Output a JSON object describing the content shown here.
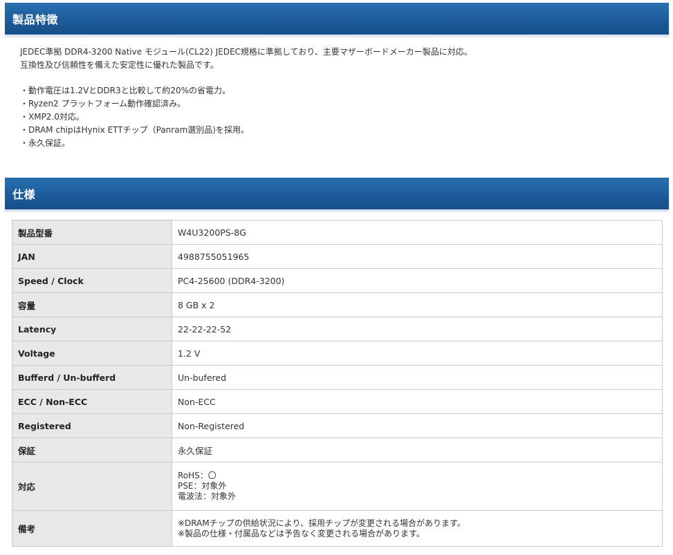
{
  "features": {
    "title": "製品特徴",
    "lines": [
      "JEDEC準拠 DDR4-3200 Native モジュール(CL22) JEDEC規格に準拠しており、主要マザーボードメーカー製品に対応。",
      "互換性及び信頼性を備えた安定性に優れた製品です。"
    ],
    "bullets": [
      "・動作電圧は1.2VとDDR3と比較して約20%の省電力。",
      "・Ryzen2 プラットフォーム動作確認済み。",
      "・XMP2.0対応。",
      "・DRAM chipはHynix ETTチップ（Panram選別品)を採用。",
      "・永久保証。"
    ]
  },
  "specs": {
    "title": "仕様",
    "rows": [
      {
        "label": "製品型番",
        "value": "W4U3200PS-8G"
      },
      {
        "label": "JAN",
        "value": "4988755051965"
      },
      {
        "label": "Speed / Clock",
        "value": "PC4-25600 (DDR4-3200)"
      },
      {
        "label": "容量",
        "value": "8 GB x 2"
      },
      {
        "label": "Latency",
        "value": "22-22-22-52"
      },
      {
        "label": "Voltage",
        "value": "1.2 V"
      },
      {
        "label": "Bufferd / Un-bufferd",
        "value": "Un-bufered"
      },
      {
        "label": "ECC / Non-ECC",
        "value": "Non-ECC"
      },
      {
        "label": "Registered",
        "value": "Non-Registered"
      },
      {
        "label": "保証",
        "value": "永久保証"
      }
    ],
    "compat": {
      "label": "対応",
      "lines": [
        "RoHS：〇",
        "PSE：対象外",
        "電波法：対象外"
      ]
    },
    "notes": {
      "label": "備考",
      "lines": [
        "※DRAMチップの供給状況により、採用チップが変更される場合があります。",
        "※製品の仕様・付属品などは予告なく変更される場合があります。"
      ]
    }
  }
}
